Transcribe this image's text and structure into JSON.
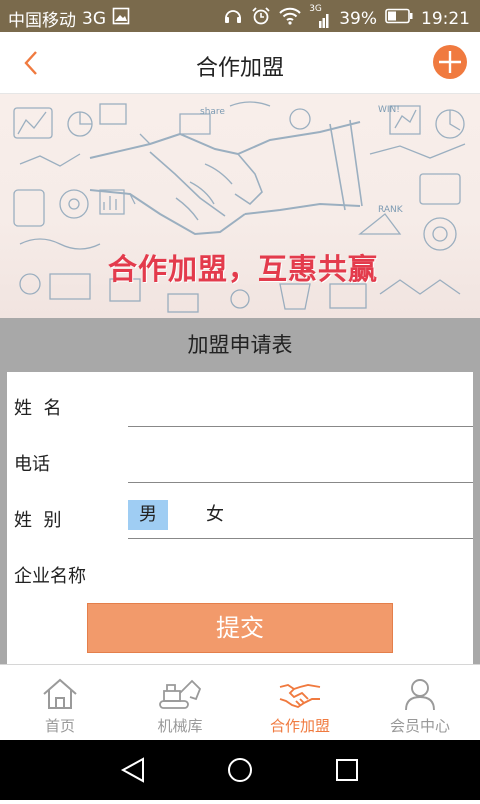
{
  "status_bar": {
    "carrier": "中国移动",
    "network": "3G",
    "signal_label": "3G",
    "battery": "39%",
    "time": "19:21"
  },
  "header": {
    "title": "合作加盟"
  },
  "banner": {
    "slogan": "合作加盟，互惠共赢",
    "doodle_words": [
      "share",
      "WIN!",
      "RANK"
    ]
  },
  "form": {
    "title": "加盟申请表",
    "fields": [
      {
        "label": "姓  名",
        "value": ""
      },
      {
        "label": "电话",
        "value": ""
      },
      {
        "label": "姓  别"
      },
      {
        "label": "企业名称",
        "value": ""
      }
    ],
    "gender_options": [
      "男",
      "女"
    ],
    "gender_selected": "男",
    "submit_label": "提交"
  },
  "tabs": [
    {
      "label": "首页",
      "icon": "home-icon",
      "active": false
    },
    {
      "label": "机械库",
      "icon": "excavator-icon",
      "active": false
    },
    {
      "label": "合作加盟",
      "icon": "handshake-icon",
      "active": true
    },
    {
      "label": "会员中心",
      "icon": "person-icon",
      "active": false
    }
  ],
  "colors": {
    "accent": "#f07a3f",
    "status_bar": "#7a6a4c",
    "submit": "#f29a6b",
    "slogan": "#e33b4c",
    "gender_selected_bg": "#9fcdf3"
  }
}
